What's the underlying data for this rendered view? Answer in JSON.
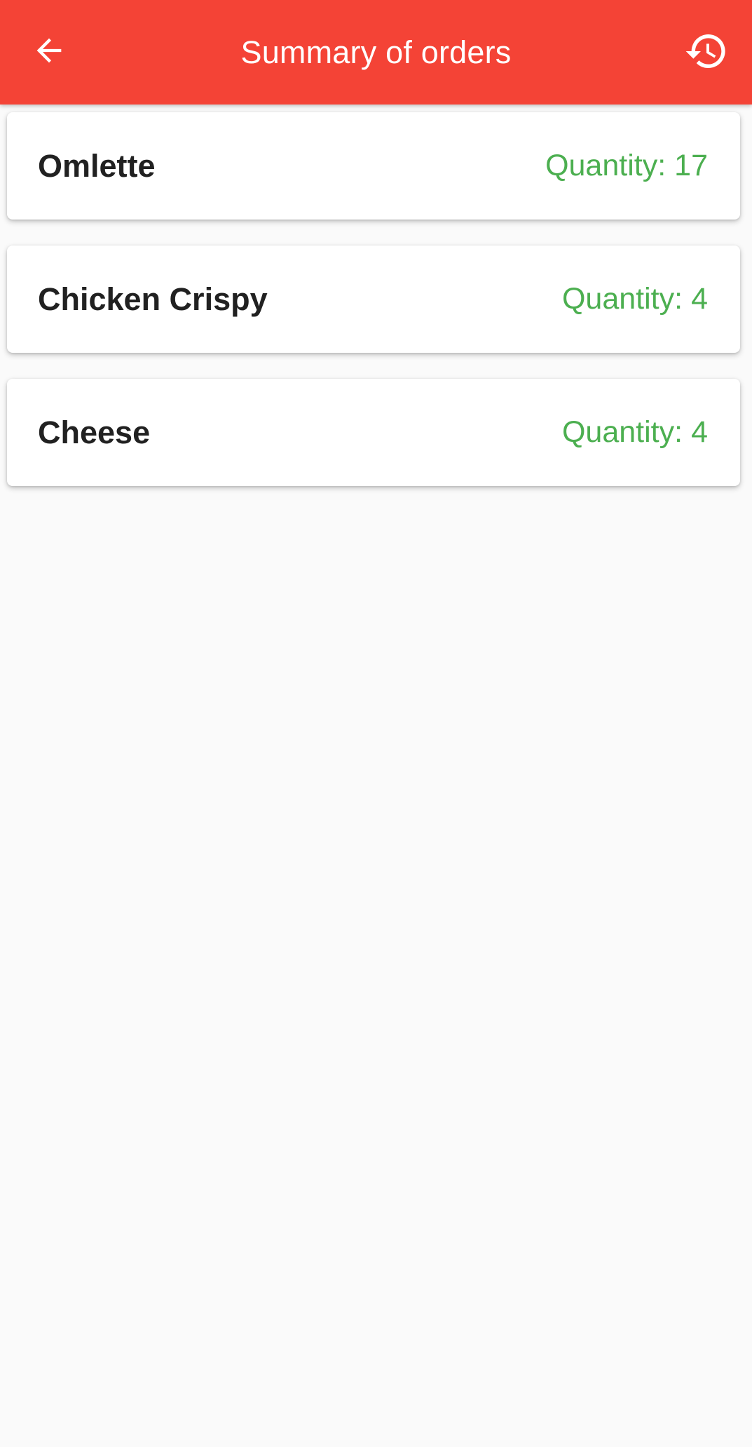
{
  "header": {
    "title": "Summary of orders",
    "back_icon": "arrow-back-icon",
    "history_icon": "history-icon",
    "background_color": "#f44336"
  },
  "orders": [
    {
      "name": "Omlette",
      "quantity_label": "Quantity:",
      "quantity": "17"
    },
    {
      "name": "Chicken Crispy",
      "quantity_label": "Quantity:",
      "quantity": "4"
    },
    {
      "name": "Cheese",
      "quantity_label": "Quantity:",
      "quantity": "4"
    }
  ],
  "colors": {
    "accent": "#f44336",
    "quantity": "#4caf50",
    "item_text": "#212121",
    "background": "#fafafa"
  }
}
